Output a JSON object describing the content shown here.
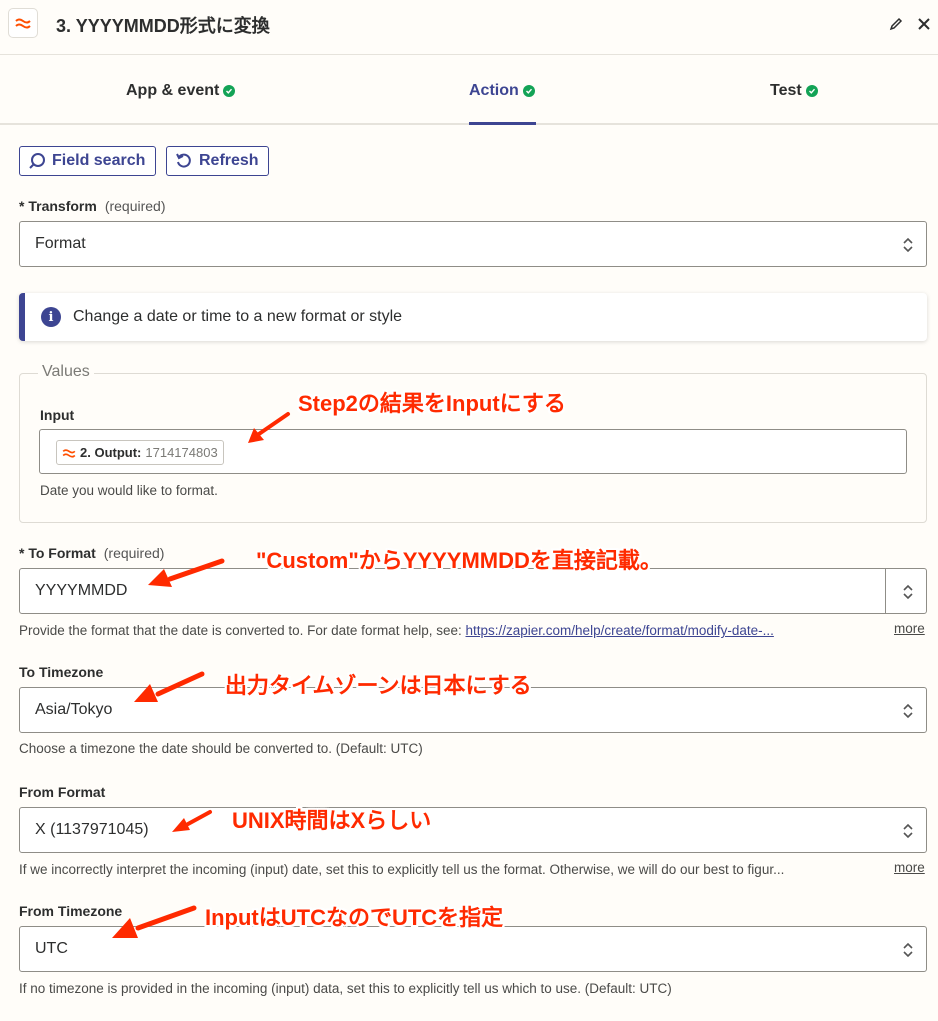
{
  "header": {
    "title": "3. YYYYMMDD形式に変換",
    "edit_icon": "pencil-icon",
    "close_icon": "close-icon"
  },
  "tabs": [
    {
      "label": "App & event",
      "status": "complete",
      "active": false
    },
    {
      "label": "Action",
      "status": "complete",
      "active": true
    },
    {
      "label": "Test",
      "status": "complete",
      "active": false
    }
  ],
  "toolbar": {
    "field_search_label": "Field search",
    "refresh_label": "Refresh"
  },
  "transform": {
    "label": "Transform",
    "required": "(required)",
    "value": "Format"
  },
  "info": {
    "text": "Change a date or time to a new format or style"
  },
  "values": {
    "legend": "Values",
    "input_label": "Input",
    "pill_step": "2. Output:",
    "pill_value": "1714174803",
    "help": "Date you would like to format."
  },
  "to_format": {
    "label": "To Format",
    "required": "(required)",
    "value": "YYYYMMDD",
    "help_prefix": "Provide the format that the date is converted to. For date format help, see: ",
    "help_link": "https://zapier.com/help/create/format/modify-date-...",
    "more": "more"
  },
  "to_timezone": {
    "label": "To Timezone",
    "value": "Asia/Tokyo",
    "help": "Choose a timezone the date should be converted to. (Default: UTC)"
  },
  "from_format": {
    "label": "From Format",
    "value": "X (1137971045)",
    "help": "If we incorrectly interpret the incoming (input) date, set this to explicitly tell us the format. Otherwise, we will do our best to figur...",
    "more": "more"
  },
  "from_timezone": {
    "label": "From Timezone",
    "value": "UTC",
    "help": "If no timezone is provided in the incoming (input) data, set this to explicitly tell us which to use. (Default: UTC)"
  },
  "annotations": [
    {
      "text": "Step2の結果をInputにする"
    },
    {
      "text": "\"Custom\"からYYYYMMDDを直接記載。"
    },
    {
      "text": "出力タイムゾーンは日本にする"
    },
    {
      "text": "UNIX時間はXらしい"
    },
    {
      "text": "InputはUTCなのでUTCを指定"
    }
  ],
  "colors": {
    "accent": "#3d4592",
    "success": "#13a356",
    "annotation": "#ff2a00",
    "brand": "#ff4f00"
  }
}
